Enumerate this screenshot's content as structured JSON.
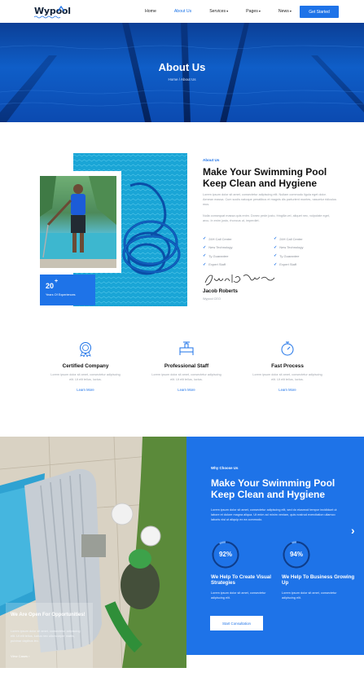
{
  "header": {
    "logo": "Wypool",
    "nav": [
      {
        "label": "Home",
        "caret": ""
      },
      {
        "label": "About Us",
        "caret": ""
      },
      {
        "label": "Services",
        "caret": "▾"
      },
      {
        "label": "Pages",
        "caret": "▾"
      },
      {
        "label": "News",
        "caret": "▾"
      }
    ],
    "cta": "Get Started"
  },
  "hero": {
    "title": "About Us",
    "breadcrumb": "Home / About Us"
  },
  "about": {
    "eyebrow": "About Us",
    "title": "Make Your Swimming Pool Keep Clean and Hygiene",
    "para1": "Lorem ipsum dolor sit amet, consectetur adipiscing elit. Nullam commodo ligula eget dolor. Aenean massa. Cum sociis natoque penatibus et magnis dis parturient montes, nascetur ridiculus mus.",
    "para2": "Nulla consequat massa quis enim. Donec pede justo, fringilla vel, aliquet nec, vulputate eget, arcu. In enim justo, rhoncus ut, imperdiet.",
    "checks_left": [
      "24H Call Center",
      "New Technology",
      "Ty Guarantee",
      "Expert Staff"
    ],
    "checks_right": [
      "24H Call Center",
      "New Technology",
      "Ty Guarantee",
      "Expert Staff"
    ],
    "experience_number": "20",
    "experience_plus": "+",
    "experience_label": "Years Of Experiences",
    "signature_text": "Jacob Roberts",
    "name": "Jacob Roberts",
    "role": "Wypool CEO"
  },
  "features": [
    {
      "icon": "award-badge-icon",
      "title": "Certified Company",
      "text": "Lorem ipsum dolor sit amet, consectetur adipiscing elit. Ut elit tellus, luctus.",
      "link": "Learn More"
    },
    {
      "icon": "pipe-valve-icon",
      "title": "Professional Staff",
      "text": "Lorem ipsum dolor sit amet, consectetur adipiscing elit. Ut elit tellus, luctus.",
      "link": "Learn More"
    },
    {
      "icon": "stopwatch-icon",
      "title": "Fast Process",
      "text": "Lorem ipsum dolor sit amet, consectetur adipiscing elit. Ut elit tellus, luctus.",
      "link": "Learn More"
    }
  ],
  "opportunities": {
    "title": "We Are Open For Opportunities!",
    "text": "Lorem ipsum dolor sit amet, consectetur adipiscing elit. Ut elit tellus, luctus nec ullamcorper mattis, pulvinar dapibus leo.",
    "link": "View Cases"
  },
  "why": {
    "eyebrow": "Why Choose Us",
    "title": "Make Your Swimming Pool Keep Clean and Hygiene",
    "text": "Lorem ipsum dolor sit amet, consectetur adipiscing elit, sed do eiusmod tempor incididunt ut labore et dolore magna aliqua. Ut enim ad minim veniam, quis nostrud exercitation ullamco laboris nisi ut aliquip ex ea commodo.",
    "stats": [
      {
        "value": 0.92,
        "label": "92%",
        "title": "We Help To Create Visual Strategies",
        "text": "Lorem ipsum dolor sit amet, consectetur adipiscing elit."
      },
      {
        "value": 0.94,
        "label": "94%",
        "title": "We Help To Business Growing Up",
        "text": "Lorem ipsum dolor sit amet, consectetur adipiscing elit."
      }
    ],
    "button": "Start Consultation"
  },
  "colors": {
    "accent": "#1e73e8",
    "dark": "#14243a"
  }
}
